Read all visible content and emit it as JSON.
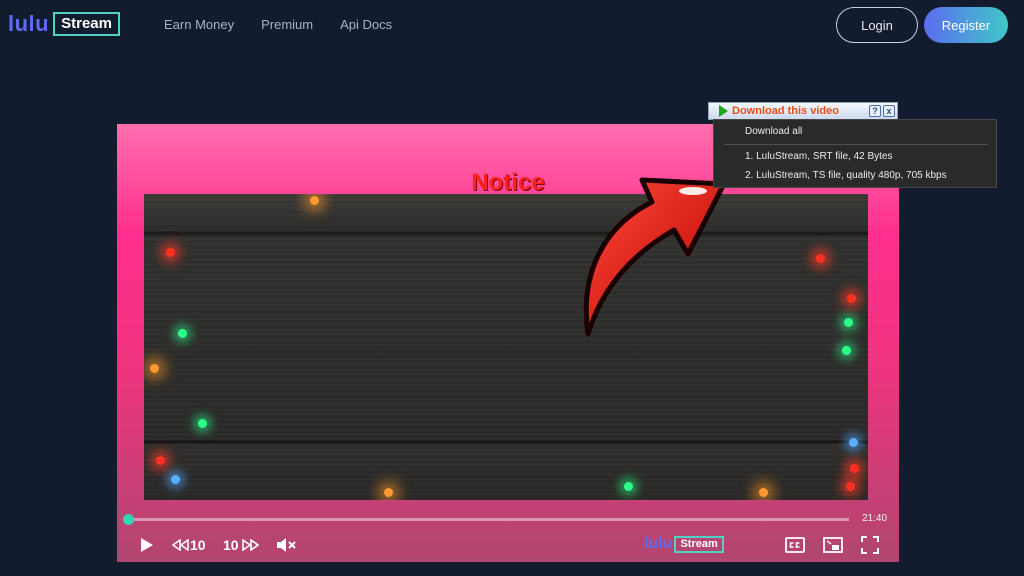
{
  "header": {
    "logo": {
      "part1": "lulu",
      "part2": "Stream"
    },
    "nav": [
      "Earn Money",
      "Premium",
      "Api Docs"
    ],
    "login_label": "Login",
    "register_label": "Register"
  },
  "player": {
    "notice": "Notice",
    "duration": "21:40",
    "progress_fraction": 0.0,
    "rewind_label": "10",
    "forward_label": "10",
    "logo": {
      "part1": "lulu",
      "part2": "Stream"
    }
  },
  "download": {
    "bar_title": "Download this video",
    "help_label": "?",
    "close_label": "x",
    "download_all": "Download all",
    "items": [
      "1.  LuluStream,  SRT file, 42 Bytes",
      "2.  LuluStream,  TS file, quality 480p, 705 kbps"
    ]
  },
  "colors": {
    "background": "#131b2e",
    "brand_blue": "#5b6cf0",
    "brand_teal": "#4fd1c5",
    "player_pink": "#ff2e8e",
    "notice_red": "#ff2020",
    "download_orange": "#e8501a"
  },
  "icons": {
    "play": "play-icon",
    "rewind": "rewind-icon",
    "forward": "forward-icon",
    "mute": "mute-icon",
    "captions": "captions-icon",
    "pip": "picture-in-picture-icon",
    "fullscreen": "fullscreen-icon"
  }
}
